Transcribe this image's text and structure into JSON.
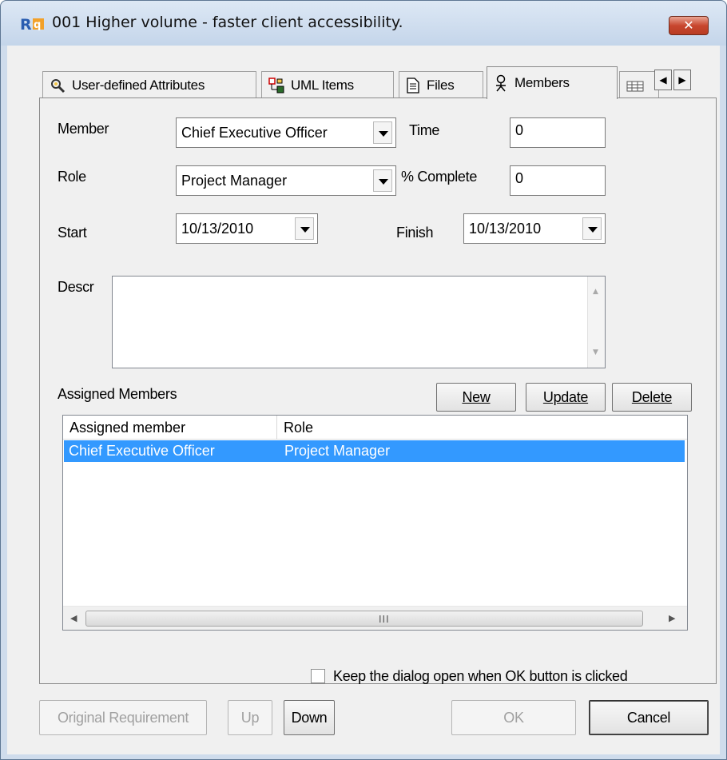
{
  "window": {
    "title": "001 Higher volume - faster client accessibility.",
    "close_label": "✕"
  },
  "tabs": [
    {
      "label": "User-defined Attributes",
      "icon": "gear-magnifier-icon"
    },
    {
      "label": "UML Items",
      "icon": "uml-diagram-icon"
    },
    {
      "label": "Files",
      "icon": "document-icon"
    },
    {
      "label": "Members",
      "icon": "person-icon",
      "active": true
    },
    {
      "label": "",
      "icon": "table-grid-icon"
    }
  ],
  "form": {
    "member_label": "Member",
    "member_value": "Chief Executive Officer",
    "role_label": "Role",
    "role_value": "Project Manager",
    "start_label": "Start",
    "start_value": "10/13/2010",
    "time_label": "Time",
    "time_value": "0",
    "complete_label": "% Complete",
    "complete_value": "0",
    "finish_label": "Finish",
    "finish_value": "10/13/2010",
    "descr_label": "Descr",
    "descr_value": ""
  },
  "assigned": {
    "heading": "Assigned Members",
    "buttons": {
      "new": "New",
      "update": "Update",
      "delete": "Delete"
    },
    "columns": [
      "Assigned member",
      "Role"
    ],
    "rows": [
      {
        "member": "Chief Executive Officer",
        "role": "Project Manager",
        "selected": true
      }
    ],
    "scroll_grip": "III"
  },
  "footer": {
    "keep_open_label": "Keep the dialog open when OK button is clicked",
    "keep_open_checked": false,
    "original_requirement": "Original Requirement",
    "up": "Up",
    "down": "Down",
    "ok": "OK",
    "cancel": "Cancel"
  },
  "colors": {
    "selection": "#3399ff",
    "frame": "#cfdcec",
    "close": "#c8472f"
  }
}
